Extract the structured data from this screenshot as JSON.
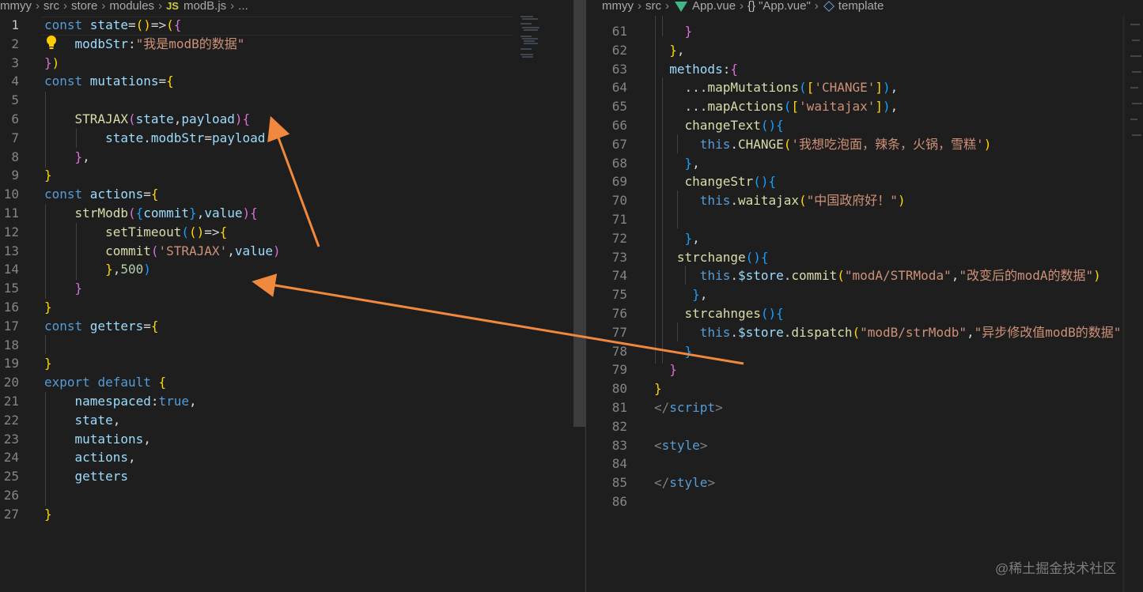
{
  "left_editor": {
    "breadcrumb": [
      "mmyy",
      "src",
      "store",
      "modules",
      "JS",
      "modB.js",
      "..."
    ],
    "lines": [
      {
        "n": "1",
        "active": true,
        "t": [
          [
            "kw",
            "const "
          ],
          [
            "var",
            "state"
          ],
          [
            "plain",
            "="
          ],
          [
            "p1",
            "()"
          ],
          [
            "plain",
            "=>"
          ],
          [
            "p1",
            "("
          ],
          [
            "p2",
            "{"
          ]
        ]
      },
      {
        "n": "2",
        "t": [
          [
            "plain",
            "    "
          ],
          [
            "var",
            "modbStr"
          ],
          [
            "plain",
            ":"
          ],
          [
            "str",
            "\"我是modB的数据\""
          ]
        ]
      },
      {
        "n": "3",
        "t": [
          [
            "p2",
            "}"
          ],
          [
            "p1",
            ")"
          ]
        ]
      },
      {
        "n": "4",
        "t": [
          [
            "kw",
            "const "
          ],
          [
            "var",
            "mutations"
          ],
          [
            "plain",
            "="
          ],
          [
            "p1",
            "{"
          ]
        ]
      },
      {
        "n": "5",
        "t": []
      },
      {
        "n": "6",
        "t": [
          [
            "plain",
            "    "
          ],
          [
            "fn",
            "STRAJAX"
          ],
          [
            "p2",
            "("
          ],
          [
            "var",
            "state"
          ],
          [
            "plain",
            ","
          ],
          [
            "var",
            "payload"
          ],
          [
            "p2",
            ")"
          ],
          [
            "p2",
            "{"
          ]
        ]
      },
      {
        "n": "7",
        "t": [
          [
            "plain",
            "        "
          ],
          [
            "var",
            "state"
          ],
          [
            "plain",
            "."
          ],
          [
            "var",
            "modbStr"
          ],
          [
            "plain",
            "="
          ],
          [
            "var",
            "payload"
          ]
        ]
      },
      {
        "n": "8",
        "t": [
          [
            "plain",
            "    "
          ],
          [
            "p2",
            "}"
          ],
          [
            "plain",
            ","
          ]
        ]
      },
      {
        "n": "9",
        "t": [
          [
            "p1",
            "}"
          ]
        ]
      },
      {
        "n": "10",
        "t": [
          [
            "kw",
            "const "
          ],
          [
            "var",
            "actions"
          ],
          [
            "plain",
            "="
          ],
          [
            "p1",
            "{"
          ]
        ]
      },
      {
        "n": "11",
        "t": [
          [
            "plain",
            "    "
          ],
          [
            "fn",
            "strModb"
          ],
          [
            "p2",
            "("
          ],
          [
            "p3",
            "{"
          ],
          [
            "var",
            "commit"
          ],
          [
            "p3",
            "}"
          ],
          [
            "plain",
            ","
          ],
          [
            "var",
            "value"
          ],
          [
            "p2",
            ")"
          ],
          [
            "p2",
            "{"
          ]
        ]
      },
      {
        "n": "12",
        "t": [
          [
            "plain",
            "        "
          ],
          [
            "fn",
            "setTimeout"
          ],
          [
            "p3",
            "("
          ],
          [
            "p1",
            "()"
          ],
          [
            "plain",
            "=>"
          ],
          [
            "p1",
            "{"
          ]
        ]
      },
      {
        "n": "13",
        "t": [
          [
            "plain",
            "        "
          ],
          [
            "fn",
            "commit"
          ],
          [
            "p2",
            "("
          ],
          [
            "str",
            "'STRAJAX'"
          ],
          [
            "plain",
            ","
          ],
          [
            "var",
            "value"
          ],
          [
            "p2",
            ")"
          ]
        ]
      },
      {
        "n": "14",
        "t": [
          [
            "plain",
            "        "
          ],
          [
            "p1",
            "}"
          ],
          [
            "plain",
            ","
          ],
          [
            "num",
            "500"
          ],
          [
            "p3",
            ")"
          ]
        ]
      },
      {
        "n": "15",
        "t": [
          [
            "plain",
            "    "
          ],
          [
            "p2",
            "}"
          ]
        ]
      },
      {
        "n": "16",
        "t": [
          [
            "p1",
            "}"
          ]
        ]
      },
      {
        "n": "17",
        "t": [
          [
            "kw",
            "const "
          ],
          [
            "var",
            "getters"
          ],
          [
            "plain",
            "="
          ],
          [
            "p1",
            "{"
          ]
        ]
      },
      {
        "n": "18",
        "t": []
      },
      {
        "n": "19",
        "t": [
          [
            "p1",
            "}"
          ]
        ]
      },
      {
        "n": "20",
        "t": [
          [
            "kw",
            "export "
          ],
          [
            "kw",
            "default "
          ],
          [
            "p1",
            "{"
          ]
        ]
      },
      {
        "n": "21",
        "t": [
          [
            "plain",
            "    "
          ],
          [
            "var",
            "namespaced"
          ],
          [
            "plain",
            ":"
          ],
          [
            "kw",
            "true"
          ],
          [
            "plain",
            ","
          ]
        ]
      },
      {
        "n": "22",
        "t": [
          [
            "plain",
            "    "
          ],
          [
            "var",
            "state"
          ],
          [
            "plain",
            ","
          ]
        ]
      },
      {
        "n": "23",
        "t": [
          [
            "plain",
            "    "
          ],
          [
            "var",
            "mutations"
          ],
          [
            "plain",
            ","
          ]
        ]
      },
      {
        "n": "24",
        "t": [
          [
            "plain",
            "    "
          ],
          [
            "var",
            "actions"
          ],
          [
            "plain",
            ","
          ]
        ]
      },
      {
        "n": "25",
        "t": [
          [
            "plain",
            "    "
          ],
          [
            "var",
            "getters"
          ]
        ]
      },
      {
        "n": "26",
        "t": []
      },
      {
        "n": "27",
        "t": [
          [
            "p1",
            "}"
          ]
        ]
      }
    ]
  },
  "right_editor": {
    "breadcrumb": [
      "mmyy",
      "src",
      "App.vue",
      "{}",
      "\"App.vue\"",
      "template"
    ],
    "lines": [
      {
        "n": "61",
        "t": [
          [
            "plain",
            "    "
          ],
          [
            "p2",
            "}"
          ]
        ]
      },
      {
        "n": "62",
        "t": [
          [
            "plain",
            "  "
          ],
          [
            "p1",
            "}"
          ],
          [
            "plain",
            ","
          ]
        ]
      },
      {
        "n": "63",
        "t": [
          [
            "plain",
            "  "
          ],
          [
            "var",
            "methods"
          ],
          [
            "plain",
            ":"
          ],
          [
            "p2",
            "{"
          ]
        ]
      },
      {
        "n": "64",
        "t": [
          [
            "plain",
            "    ..."
          ],
          [
            "fn",
            "mapMutations"
          ],
          [
            "p3",
            "("
          ],
          [
            "p1",
            "["
          ],
          [
            "str",
            "'CHANGE'"
          ],
          [
            "p1",
            "]"
          ],
          [
            "p3",
            ")"
          ],
          [
            "plain",
            ","
          ]
        ]
      },
      {
        "n": "65",
        "t": [
          [
            "plain",
            "    ..."
          ],
          [
            "fn",
            "mapActions"
          ],
          [
            "p3",
            "("
          ],
          [
            "p1",
            "["
          ],
          [
            "str",
            "'waitajax'"
          ],
          [
            "p1",
            "]"
          ],
          [
            "p3",
            ")"
          ],
          [
            "plain",
            ","
          ]
        ]
      },
      {
        "n": "66",
        "t": [
          [
            "plain",
            "    "
          ],
          [
            "fn",
            "changeText"
          ],
          [
            "p3",
            "()"
          ],
          [
            "p3",
            "{"
          ]
        ]
      },
      {
        "n": "67",
        "t": [
          [
            "plain",
            "      "
          ],
          [
            "kw",
            "this"
          ],
          [
            "plain",
            "."
          ],
          [
            "fn",
            "CHANGE"
          ],
          [
            "p1",
            "("
          ],
          [
            "str",
            "'我想吃泡面，辣条，火锅，雪糕'"
          ],
          [
            "p1",
            ")"
          ]
        ]
      },
      {
        "n": "68",
        "t": [
          [
            "plain",
            "    "
          ],
          [
            "p3",
            "}"
          ],
          [
            "plain",
            ","
          ]
        ]
      },
      {
        "n": "69",
        "t": [
          [
            "plain",
            "    "
          ],
          [
            "fn",
            "changeStr"
          ],
          [
            "p3",
            "()"
          ],
          [
            "p3",
            "{"
          ]
        ]
      },
      {
        "n": "70",
        "t": [
          [
            "plain",
            "      "
          ],
          [
            "kw",
            "this"
          ],
          [
            "plain",
            "."
          ],
          [
            "fn",
            "waitajax"
          ],
          [
            "p1",
            "("
          ],
          [
            "str",
            "\"中国政府好！\""
          ],
          [
            "p1",
            ")"
          ]
        ]
      },
      {
        "n": "71",
        "t": []
      },
      {
        "n": "72",
        "t": [
          [
            "plain",
            "    "
          ],
          [
            "p3",
            "}"
          ],
          [
            "plain",
            ","
          ]
        ]
      },
      {
        "n": "73",
        "t": [
          [
            "plain",
            "   "
          ],
          [
            "fn",
            "strchange"
          ],
          [
            "p3",
            "()"
          ],
          [
            "p3",
            "{"
          ]
        ]
      },
      {
        "n": "74",
        "t": [
          [
            "plain",
            "      "
          ],
          [
            "kw",
            "this"
          ],
          [
            "plain",
            "."
          ],
          [
            "var",
            "$store"
          ],
          [
            "plain",
            "."
          ],
          [
            "fn",
            "commit"
          ],
          [
            "p1",
            "("
          ],
          [
            "str",
            "\"modA/STRModa\""
          ],
          [
            "plain",
            ","
          ],
          [
            "str",
            "\"改变后的modA的数据\""
          ],
          [
            "p1",
            ")"
          ]
        ]
      },
      {
        "n": "75",
        "t": [
          [
            "plain",
            "     "
          ],
          [
            "p3",
            "}"
          ],
          [
            "plain",
            ","
          ]
        ]
      },
      {
        "n": "76",
        "t": [
          [
            "plain",
            "    "
          ],
          [
            "fn",
            "strcahnges"
          ],
          [
            "p3",
            "()"
          ],
          [
            "p3",
            "{"
          ]
        ]
      },
      {
        "n": "77",
        "t": [
          [
            "plain",
            "      "
          ],
          [
            "kw",
            "this"
          ],
          [
            "plain",
            "."
          ],
          [
            "var",
            "$store"
          ],
          [
            "plain",
            "."
          ],
          [
            "fn",
            "dispatch"
          ],
          [
            "p1",
            "("
          ],
          [
            "str",
            "\"modB/strModb\""
          ],
          [
            "plain",
            ","
          ],
          [
            "str",
            "\"异步修改值modB的数据\""
          ]
        ]
      },
      {
        "n": "78",
        "t": [
          [
            "plain",
            "    "
          ],
          [
            "p3",
            "}"
          ]
        ]
      },
      {
        "n": "79",
        "t": [
          [
            "plain",
            "  "
          ],
          [
            "p2",
            "}"
          ]
        ]
      },
      {
        "n": "80",
        "t": [
          [
            "p1",
            "}"
          ]
        ]
      },
      {
        "n": "81",
        "t": [
          [
            "tag",
            "</"
          ],
          [
            "tagname",
            "script"
          ],
          [
            "tag",
            ">"
          ]
        ]
      },
      {
        "n": "82",
        "t": []
      },
      {
        "n": "83",
        "t": [
          [
            "tag",
            "<"
          ],
          [
            "tagname",
            "style"
          ],
          [
            "tag",
            ">"
          ]
        ]
      },
      {
        "n": "84",
        "t": []
      },
      {
        "n": "85",
        "t": [
          [
            "tag",
            "</"
          ],
          [
            "tagname",
            "style"
          ],
          [
            "tag",
            ">"
          ]
        ]
      },
      {
        "n": "86",
        "t": []
      }
    ]
  },
  "watermark": "@稀土掘金技术社区",
  "colors": {
    "arrow": "#f0883e",
    "background": "#1e1e1e"
  }
}
